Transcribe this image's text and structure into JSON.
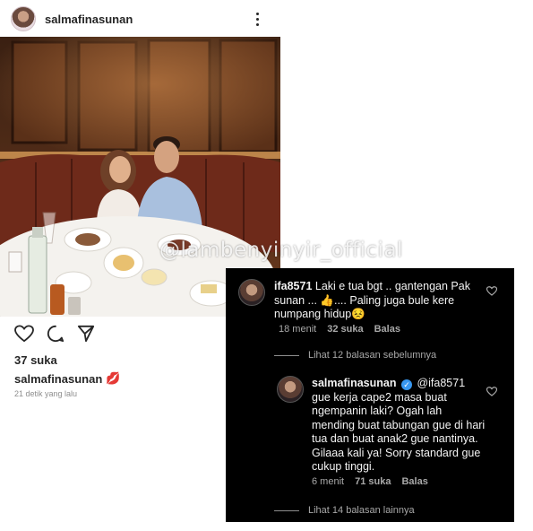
{
  "post": {
    "username": "salmafinasunan",
    "likes": "37 suka",
    "caption_user": "salmafinasunan",
    "caption_emoji": "💋",
    "timestamp": "21 detik yang lalu"
  },
  "watermark": "@lambenyinyir_official",
  "comments": {
    "first": {
      "username": "ifa8571",
      "text": "Laki e tua bgt .. gantengan Pak sunan ... 👍.... Paling juga bule kere numpang hidup😣",
      "time": "18 menit",
      "likes": "32 suka",
      "reply": "Balas"
    },
    "view_previous": "Lihat 12 balasan sebelumnya",
    "second": {
      "username": "salmafinasunan",
      "mention": "@ifa8571",
      "text": "gue kerja cape2 masa buat ngempanin laki? Ogah lah mending buat tabungan gue di hari tua dan buat anak2 gue nantinya. Gilaaa kali ya! Sorry standard gue cukup tinggi.",
      "time": "6 menit",
      "likes": "71 suka",
      "reply": "Balas"
    },
    "view_more": "Lihat 14 balasan lainnya"
  },
  "colors": {
    "dark_bg": "#000000",
    "verified": "#3897f0",
    "muted": "#a8a8a8"
  }
}
